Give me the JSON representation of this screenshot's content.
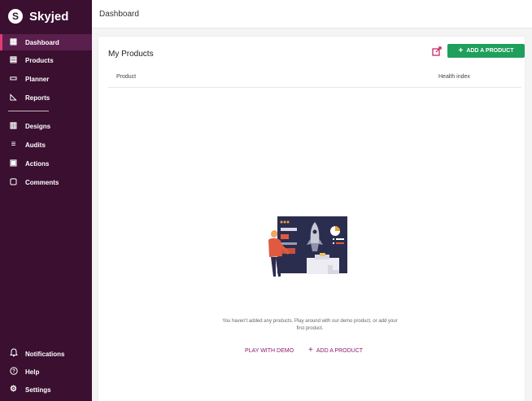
{
  "brand": {
    "logo_glyph": "S",
    "name": "Skyjed"
  },
  "sidebar": {
    "items": [
      {
        "label": "Dashboard",
        "icon": "dashboard-icon",
        "glyph": "▦",
        "active": true
      },
      {
        "label": "Products",
        "icon": "products-icon",
        "glyph": "▤"
      },
      {
        "label": "Planner",
        "icon": "planner-icon",
        "glyph": "▭"
      },
      {
        "label": "Reports",
        "icon": "reports-icon",
        "glyph": "◺"
      },
      {
        "label": "Designs",
        "icon": "designs-icon",
        "glyph": "▥"
      },
      {
        "label": "Audits",
        "icon": "audits-icon",
        "glyph": "≡"
      },
      {
        "label": "Actions",
        "icon": "actions-icon",
        "glyph": "▣"
      },
      {
        "label": "Comments",
        "icon": "comments-icon",
        "glyph": "▢"
      }
    ],
    "bottom_items": [
      {
        "label": "Notifications",
        "icon": "bell-icon",
        "glyph": "🔔"
      },
      {
        "label": "Help",
        "icon": "help-icon",
        "glyph": "?"
      },
      {
        "label": "Settings",
        "icon": "gear-icon",
        "glyph": "⚙"
      }
    ]
  },
  "header": {
    "title": "Dashboard"
  },
  "card": {
    "title": "My Products",
    "edit_icon": "external-edit-icon",
    "add_label": "ADD A PRODUCT",
    "columns": [
      "Product",
      "Health index"
    ]
  },
  "empty_state": {
    "message": "You haven't added any products. Play around with our demo product, or add your first product.",
    "play_label": "PLAY WITH DEMO",
    "add_label": "ADD A PRODUCT"
  },
  "colors": {
    "sidebar_bg": "#3a0f2f",
    "accent": "#e53977",
    "add_button": "#1f9f5c",
    "link": "#8e1b6b"
  }
}
